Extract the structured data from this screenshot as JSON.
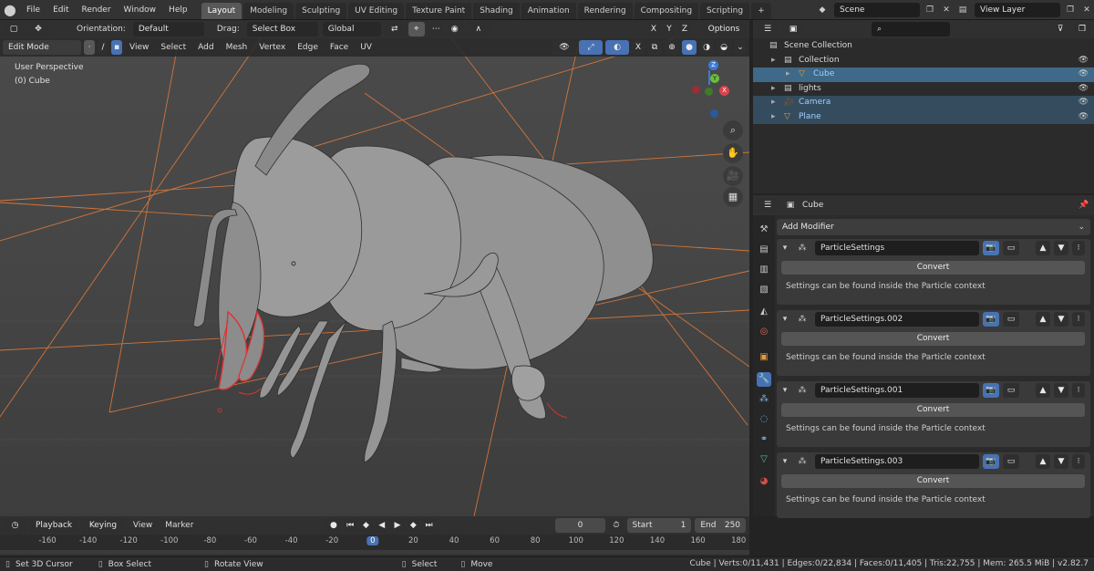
{
  "app": {
    "logo": "blender-logo",
    "menus": [
      "File",
      "Edit",
      "Render",
      "Window",
      "Help"
    ],
    "workspaces": [
      "Layout",
      "Modeling",
      "Sculpting",
      "UV Editing",
      "Texture Paint",
      "Shading",
      "Animation",
      "Rendering",
      "Compositing",
      "Scripting"
    ],
    "active_workspace": "Layout",
    "add_workspace": "+",
    "scene": "Scene",
    "view_layer": "View Layer"
  },
  "tool_header": {
    "orientation_label": "Orientation:",
    "orientation_value": "Default",
    "drag_label": "Drag:",
    "drag_value": "Select Box",
    "transform_value": "Global",
    "axes": [
      "X",
      "Y",
      "Z"
    ],
    "options": "Options"
  },
  "viewport_header": {
    "mode": "Edit Mode",
    "menus": [
      "View",
      "Select",
      "Add",
      "Mesh",
      "Vertex",
      "Edge",
      "Face",
      "UV"
    ],
    "x_label": "X"
  },
  "viewport": {
    "perspective": "User Perspective",
    "object": "(0) Cube",
    "gizmo_axes": [
      "Z",
      "Y",
      "X"
    ]
  },
  "outliner": {
    "search_placeholder": "",
    "items": [
      {
        "label": "Scene Collection",
        "indent": 0,
        "state": "normal"
      },
      {
        "label": "Collection",
        "indent": 1,
        "state": "normal"
      },
      {
        "label": "Cube",
        "indent": 2,
        "state": "active"
      },
      {
        "label": "lights",
        "indent": 1,
        "state": "normal"
      },
      {
        "label": "Camera",
        "indent": 1,
        "state": "selected"
      },
      {
        "label": "Plane",
        "indent": 1,
        "state": "selected"
      }
    ]
  },
  "properties": {
    "object_name": "Cube",
    "add_modifier": "Add Modifier",
    "modifiers": [
      {
        "name": "ParticleSettings",
        "button": "Convert",
        "note": "Settings can be found inside the Particle context"
      },
      {
        "name": "ParticleSettings.002",
        "button": "Convert",
        "note": "Settings can be found inside the Particle context"
      },
      {
        "name": "ParticleSettings.001",
        "button": "Convert",
        "note": "Settings can be found inside the Particle context"
      },
      {
        "name": "ParticleSettings.003",
        "button": "Convert",
        "note": "Settings can be found inside the Particle context"
      }
    ]
  },
  "timeline": {
    "playback": "Playback",
    "keying": "Keying",
    "view": "View",
    "marker": "Marker",
    "current_frame": "0",
    "start_label": "Start",
    "start_value": "1",
    "end_label": "End",
    "end_value": "250",
    "ruler": [
      "-160",
      "-140",
      "-120",
      "-100",
      "-80",
      "-60",
      "-40",
      "-20",
      "0",
      "20",
      "40",
      "60",
      "80",
      "100",
      "120",
      "140",
      "160",
      "180"
    ]
  },
  "status": {
    "left": [
      {
        "icon": "mouse-left-icon",
        "label": "Set 3D Cursor"
      },
      {
        "icon": "mouse-left-icon",
        "label": "Box Select"
      },
      {
        "icon": "mouse-middle-icon",
        "label": "Rotate View"
      },
      {
        "icon": "mouse-left-icon",
        "label": "Select"
      },
      {
        "icon": "mouse-left-icon",
        "label": "Move"
      }
    ],
    "stats": "Cube | Verts:0/11,431 | Edges:0/22,834 | Faces:0/11,405 | Tris:22,755 | Mem: 265.5 MiB | v2.82.7"
  },
  "colors": {
    "accent": "#4772b3",
    "selected_row": "#3f6988",
    "wire_orange": "#e07a3a",
    "edit_red": "#e03030"
  }
}
